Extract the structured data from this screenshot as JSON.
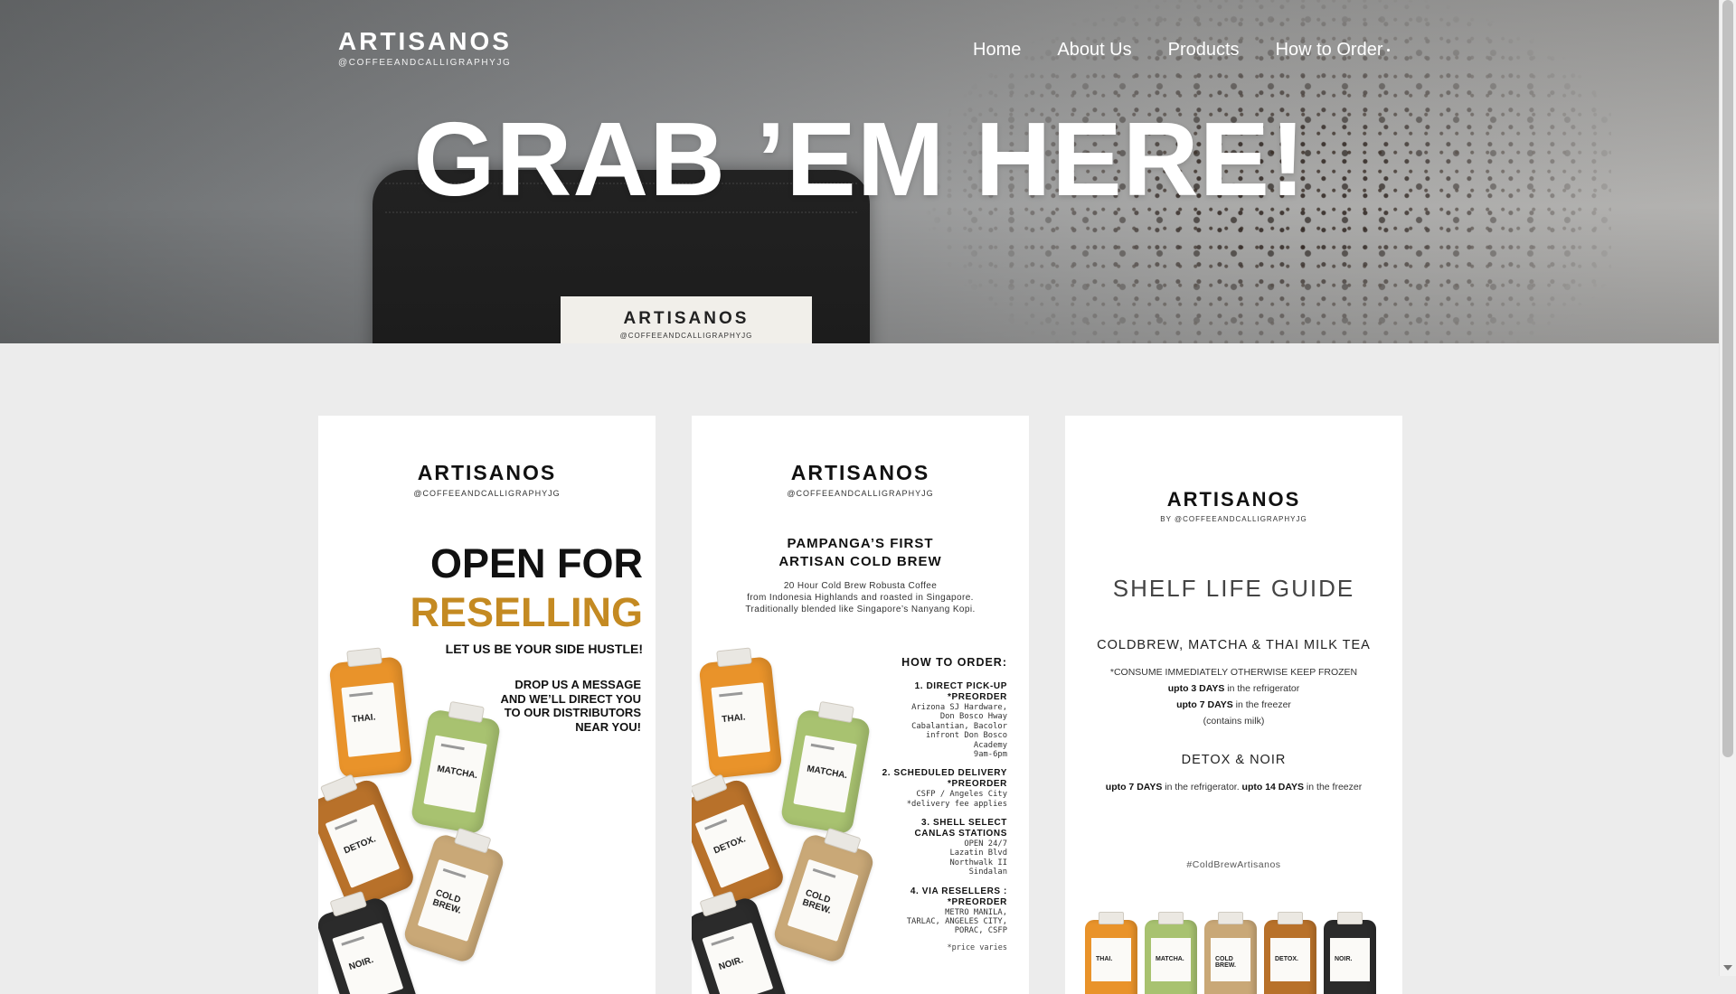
{
  "logo": {
    "name": "ARTISANOS",
    "handle": "@COFFEEANDCALLIGRAPHYJG"
  },
  "nav": {
    "items": [
      "Home",
      "About Us",
      "Products",
      "How to Order"
    ]
  },
  "hero": {
    "title": "GRAB ’EM HERE!",
    "bag_label": {
      "name": "ARTISANOS",
      "handle": "@COFFEEANDCALLIGRAPHYJG"
    }
  },
  "cards": {
    "reselling": {
      "brand": "ARTISANOS",
      "handle": "@COFFEEANDCALLIGRAPHYJG",
      "line1": "OPEN FOR",
      "line2": "RESELLING",
      "subline": "LET US BE YOUR SIDE HUSTLE!",
      "message": "DROP US A MESSAGE AND WE’LL DIRECT YOU TO OUR DISTRIBUTORS NEAR YOU!",
      "bottles": [
        "THAI.",
        "MATCHA.",
        "DETOX.",
        "COLD BREW.",
        "NOIR."
      ]
    },
    "ordering": {
      "brand": "ARTISANOS",
      "handle": "@COFFEEANDCALLIGRAPHYJG",
      "headline1": "PAMPANGA’S FIRST",
      "headline2": "ARTISAN COLD BREW",
      "desc1": "20 Hour Cold Brew Robusta Coffee",
      "desc2": "from Indonesia Highlands and roasted in Singapore.",
      "desc3": "Traditionally blended like Singapore’s Nanyang Kopi.",
      "how_title": "HOW TO ORDER:",
      "steps": [
        {
          "title": "1. DIRECT PICK-UP\n*PREORDER",
          "detail": "Arizona SJ Hardware,\nDon Bosco Hway\nCabalantian, Bacolor\ninfront Don Bosco\nAcademy\n9am-6pm"
        },
        {
          "title": "2. SCHEDULED DELIVERY\n*PREORDER",
          "detail": "CSFP / Angeles City\n*delivery fee applies"
        },
        {
          "title": "3. SHELL SELECT\nCANLAS STATIONS",
          "detail": "OPEN 24/7\nLazatin Blvd\nNorthwalk II\nSindalan"
        },
        {
          "title": "4. VIA RESELLERS :\n*PREORDER",
          "detail": "METRO MANILA,\nTARLAC, ANGELES CITY,\nPORAC, CSFP"
        }
      ],
      "price_note": "*price varies",
      "bottles": [
        "THAI.",
        "MATCHA.",
        "DETOX.",
        "COLD BREW.",
        "NOIR."
      ]
    },
    "shelf_life": {
      "brand": "ARTISANOS",
      "handle": "BY  @COFFEEANDCALLIGRAPHYJG",
      "title": "SHELF LIFE GUIDE",
      "section1": "COLDBREW, MATCHA & THAI MILK TEA",
      "note": "*CONSUME IMMEDIATELY OTHERWISE KEEP FROZEN",
      "fridge_days": "upto 3 DAYS",
      "fridge_text": " in the refrigerator",
      "freezer_days": "upto 7 DAYS",
      "freezer_text": " in the freezer",
      "milk": "(contains milk)",
      "section2": "DETOX & NOIR",
      "detox_fridge_days": "upto 7 DAYS",
      "detox_fridge_text": " in the refrigerator.",
      "detox_freezer_days": "upto 14 DAYS",
      "detox_freezer_text": " in the freezer",
      "hashtag": "#ColdBrewArtisanos",
      "bottles": [
        "THAI.",
        "MATCHA.",
        "COLD BREW.",
        "DETOX.",
        "NOIR."
      ]
    }
  },
  "colors": {
    "accent_gold": "#c48a22",
    "thai": "#e9932a",
    "matcha": "#a8c270",
    "detox": "#b8712a",
    "coldbrew": "#c9a877",
    "noir": "#2b2b2b"
  }
}
